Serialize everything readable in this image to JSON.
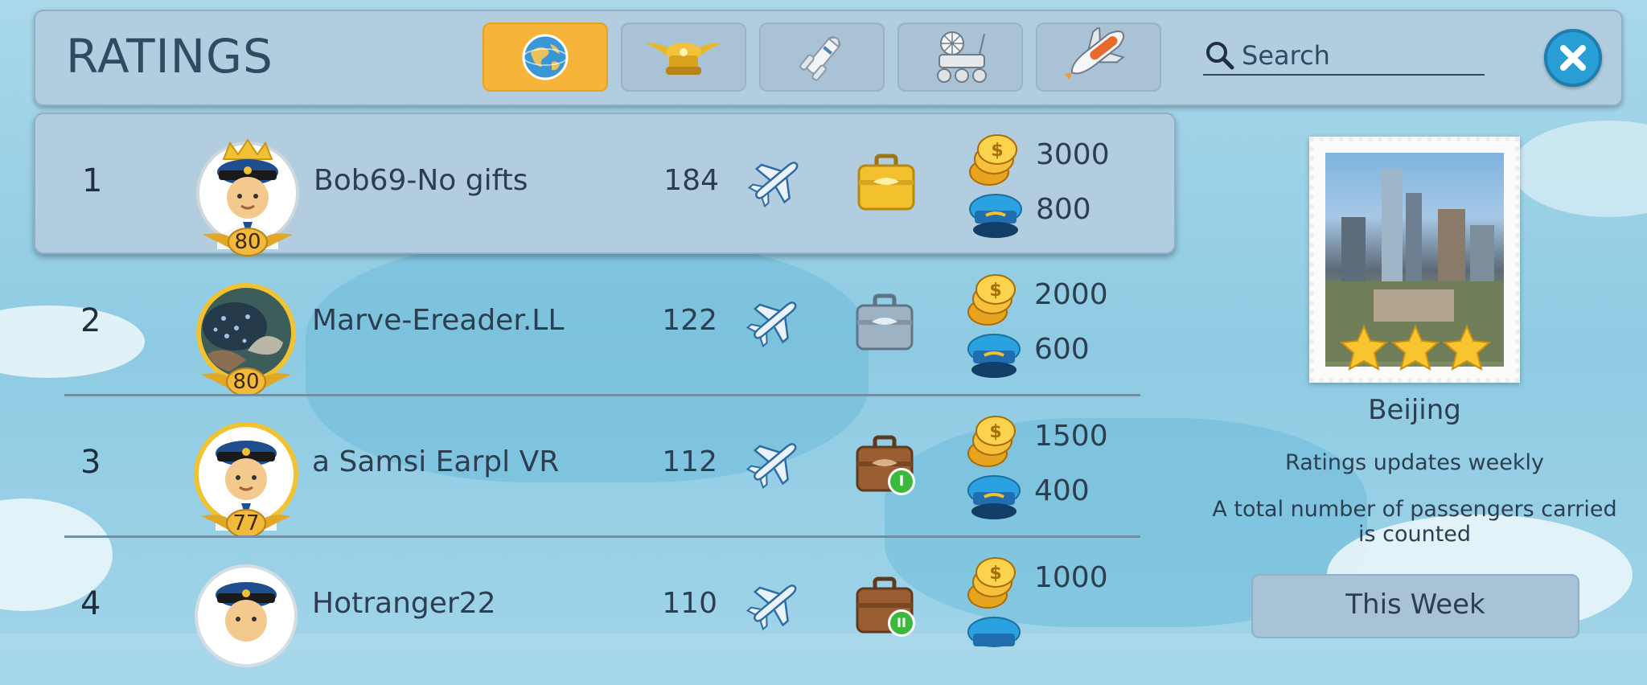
{
  "header": {
    "title": "RATINGS",
    "tabs": [
      {
        "icon": "globe-icon",
        "active": true
      },
      {
        "icon": "pilot-cap-wings-icon",
        "active": false
      },
      {
        "icon": "rocket-icon",
        "active": false
      },
      {
        "icon": "lunar-rover-icon",
        "active": false
      },
      {
        "icon": "space-shuttle-icon",
        "active": false
      }
    ],
    "search": {
      "placeholder": "Search",
      "value": ""
    },
    "close_icon": "close-icon"
  },
  "rows": [
    {
      "rank": "1",
      "name": "Bob69-No gifts",
      "level": "80",
      "score": "184",
      "case": "gold-briefcase-icon",
      "coins": "3000",
      "caps": "800",
      "highlight": true
    },
    {
      "rank": "2",
      "name": "Marve-Ereader.LL",
      "level": "80",
      "score": "122",
      "case": "silver-briefcase-icon",
      "coins": "2000",
      "caps": "600"
    },
    {
      "rank": "3",
      "name": "a Samsi Earpl VR",
      "level": "77",
      "score": "112",
      "case": "brown-briefcase-icon",
      "case_badge": "I",
      "coins": "1500",
      "caps": "400"
    },
    {
      "rank": "4",
      "name": "Hotranger22",
      "level": "",
      "score": "110",
      "case": "brown-briefcase-icon",
      "case_badge": "II",
      "coins": "1000",
      "caps": ""
    }
  ],
  "panel": {
    "city": "Beijing",
    "stars": 3,
    "info1": "Ratings updates weekly",
    "info2": "A total number of passengers carried is counted",
    "week_button": "This Week"
  },
  "colors": {
    "accent": "#f6b53a",
    "close": "#2a9fd6",
    "panel": "#b3cde0"
  }
}
